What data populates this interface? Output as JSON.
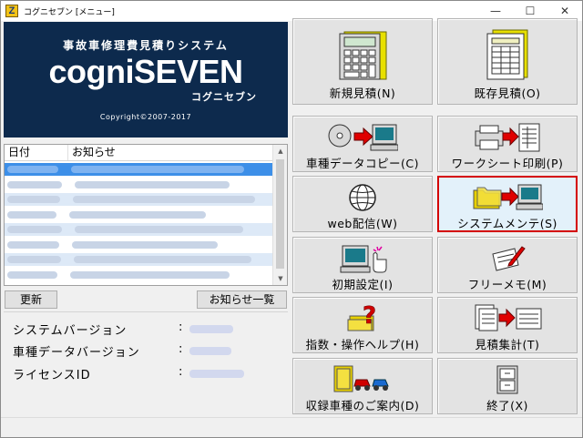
{
  "window": {
    "title": "コグニセブン [メニュー]",
    "app_icon_letter": "Z",
    "controls": [
      "—",
      "☐",
      "✕"
    ]
  },
  "banner": {
    "tagline": "事故車修理費見積りシステム",
    "logo": "cogniSEVEN",
    "logo_kana": "コグニセブン",
    "copyright": "Copyright©2007-2017"
  },
  "news": {
    "columns": [
      "日付",
      "お知らせ"
    ],
    "rows_note": "blurred",
    "rows": [
      {
        "selected": true
      },
      {
        "selected": false
      },
      {
        "selected": false
      },
      {
        "selected": false
      },
      {
        "selected": false
      },
      {
        "selected": false
      },
      {
        "selected": false
      },
      {
        "selected": false
      }
    ],
    "refresh_label": "更新",
    "list_all_label": "お知らせ一覧"
  },
  "info": {
    "rows": [
      {
        "label": "システムバージョン",
        "sep": ":"
      },
      {
        "label": "車種データバージョン",
        "sep": ":"
      },
      {
        "label": "ライセンスID",
        "sep": ":"
      }
    ]
  },
  "menu": {
    "new_estimate": "新規見積(N)",
    "existing_estimate": "既存見積(O)",
    "vehicle_data_copy": "車種データコピー(C)",
    "worksheet_print": "ワークシート印刷(P)",
    "web_delivery": "web配信(W)",
    "system_maintenance": "システムメンテ(S)",
    "initial_settings": "初期設定(I)",
    "free_memo": "フリーメモ(M)",
    "index_help": "指数・操作ヘルプ(H)",
    "estimate_summary": "見積集計(T)",
    "vehicle_guide": "収録車種のご案内(D)",
    "exit": "終了(X)"
  },
  "colors": {
    "banner_bg": "#0d2a4d",
    "selected_border": "#d40000",
    "selected_bg": "#e3f1fa",
    "row_highlight": "#3d8fe8",
    "row_alt": "#dde9f7"
  }
}
